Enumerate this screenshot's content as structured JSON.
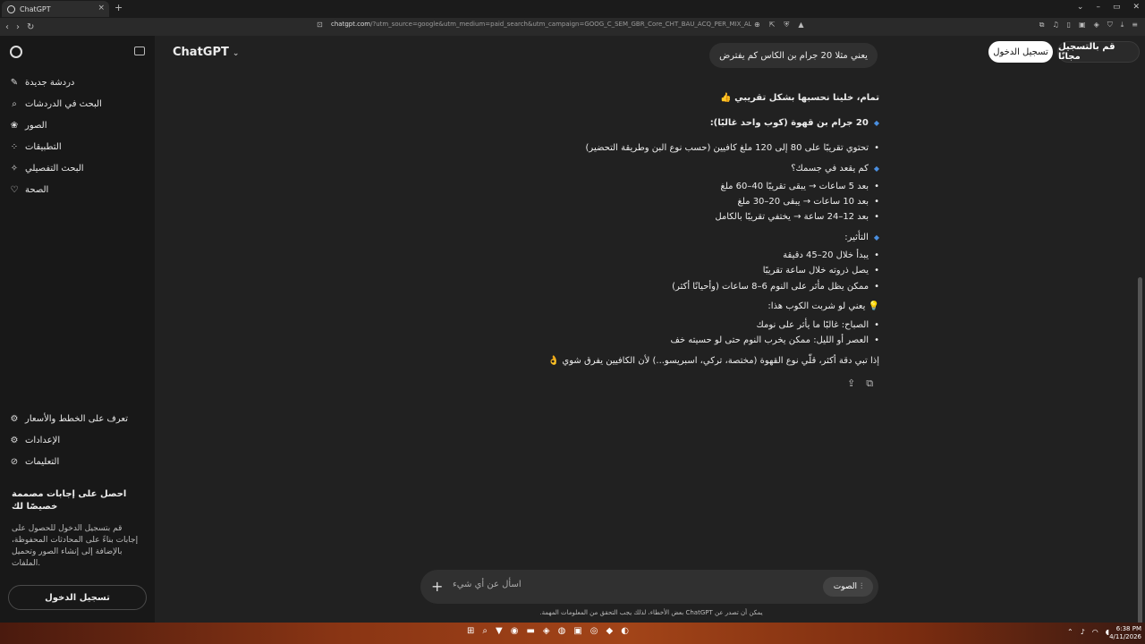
{
  "browser": {
    "tab_title": "ChatGPT",
    "tab_close": "×",
    "new_tab": "+",
    "url_domain": "chatgpt.com",
    "url_rest": "/?utm_source=google&utm_medium=paid_search&utm_campaign=GOOG_C_SEM_GBR_Core_CHT_BAU_ACQ_PER_MIX_ALL_EMEA..."
  },
  "sidebar": {
    "items": [
      {
        "icon": "new-chat-icon",
        "label": "دردشة جديدة"
      },
      {
        "icon": "search-icon",
        "label": "البحث في الدردشات"
      },
      {
        "icon": "images-icon",
        "label": "الصور"
      },
      {
        "icon": "apps-icon",
        "label": "التطبيقات"
      },
      {
        "icon": "deep-research-icon",
        "label": "البحث التفصيلي"
      },
      {
        "icon": "health-icon",
        "label": "الصحة"
      }
    ],
    "bottom_items": [
      {
        "icon": "plans-icon",
        "label": "تعرف على الخطط والأسعار"
      },
      {
        "icon": "settings-icon",
        "label": "الإعدادات"
      },
      {
        "icon": "help-icon",
        "label": "التعليمات"
      }
    ],
    "promo_title": "احصل على إجابات مصممة خصيصًا لك",
    "promo_body": "قم بتسجيل الدخول للحصول على إجابات بناءً على المحادثات المحفوظة، بالإضافة إلى إنشاء الصور وتحميل الملفات.",
    "login_label": "تسجيل الدخول"
  },
  "header": {
    "brand": "ChatGPT",
    "login": "تسجيل الدخول",
    "signup": "قم بالتسجيل مجانًا"
  },
  "conversation": {
    "user_message": "يعني مثلا 20 جرام بن الكاس كم يفترض",
    "response": {
      "intro": "تمام، خلينا نحسبها بشكل تقريبي 👍",
      "sec1_title": "20 جرام بن قهوة (كوب واحد غالبًا):",
      "sec1_item": "تحتوي تقريبًا على 80 إلى 120 ملغ كافيين (حسب نوع البن وطريقة التحضير)",
      "sec2_title": "كم يقعد في جسمك؟",
      "sec2_items": [
        "بعد 5 ساعات → يبقى تقريبًا 40–60 ملغ",
        "بعد 10 ساعات → يبقى 20–30 ملغ",
        "بعد 12–24 ساعة → يختفي تقريبًا بالكامل"
      ],
      "sec3_title": "التأثير:",
      "sec3_items": [
        "يبدأ خلال 20–45 دقيقة",
        "يصل ذروته خلال ساعة تقريبًا",
        "ممكن يظل مأثر على النوم 6–8 ساعات (وأحيانًا أكثر)"
      ],
      "sec4_title": "💡 يعني لو شربت الكوب هذا:",
      "sec4_items": [
        "الصباح: غالبًا ما يأثر على نومك",
        "العصر أو الليل: ممكن يخرب النوم حتى لو حسيته خف"
      ],
      "closing": "إذا تبي دقة أكثر، قلّي نوع القهوة (مختصة، تركي، اسبريسو...) لأن الكافيين يفرق شوي 👌"
    }
  },
  "composer": {
    "placeholder": "اسأل عن أي شيء",
    "voice_label": "الصوت",
    "disclaimer": "يمكن أن تصدر عن ChatGPT بعض الأخطاء، لذلك يجب التحقق من المعلومات المهمة."
  },
  "taskbar": {
    "time": "6:38 PM",
    "date": "4/11/2026"
  }
}
